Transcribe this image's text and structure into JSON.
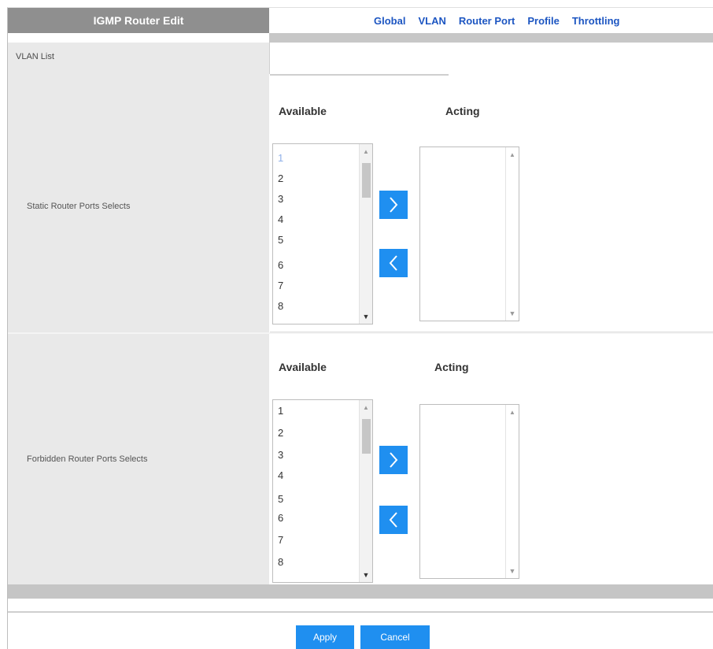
{
  "header": {
    "title": "IGMP Router Edit",
    "nav": [
      "Global",
      "VLAN",
      "Router Port",
      "Profile",
      "Throttling"
    ]
  },
  "vlan_list_label": "VLAN List",
  "static": {
    "label": "Static Router Ports Selects",
    "available_header": "Available",
    "acting_header": "Acting",
    "available_items": [
      "1",
      "2",
      "3",
      "4",
      "5",
      "6",
      "7",
      "8"
    ]
  },
  "forbidden": {
    "label": "Forbidden Router Ports Selects",
    "available_header": "Available",
    "acting_header": "Acting",
    "available_items": [
      "1",
      "2",
      "3",
      "4",
      "5",
      "6",
      "7",
      "8"
    ]
  },
  "buttons": {
    "apply": "Apply",
    "cancel": "Cancel"
  },
  "colors": {
    "accent": "#1f8ff0",
    "link": "#1d56c2",
    "header_tab": "#8f8f8f"
  },
  "icons": {
    "move_right": "chevron-right-icon",
    "move_left": "chevron-left-icon"
  }
}
